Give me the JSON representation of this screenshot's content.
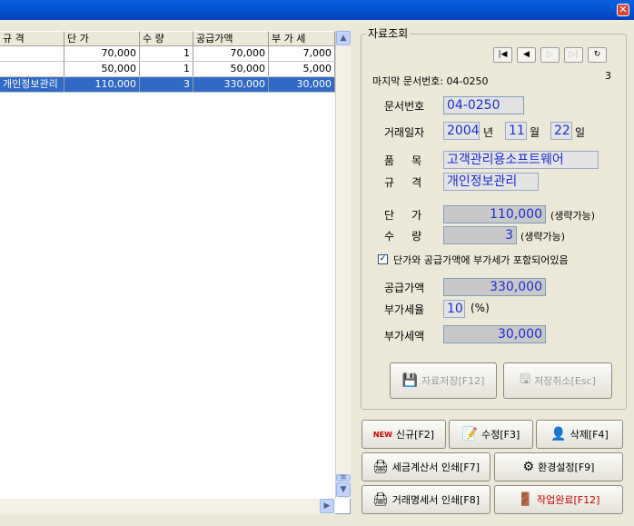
{
  "grid": {
    "columns": [
      "규 격",
      "단 가",
      "수 량",
      "공급가액",
      "부 가 세"
    ],
    "rows": [
      {
        "spec": "",
        "price": "70,000",
        "qty": "1",
        "supply": "70,000",
        "vat": "7,000",
        "selected": false
      },
      {
        "spec": "",
        "price": "50,000",
        "qty": "1",
        "supply": "50,000",
        "vat": "5,000",
        "selected": false
      },
      {
        "spec": "개인정보관리",
        "price": "110,000",
        "qty": "3",
        "supply": "330,000",
        "vat": "30,000",
        "selected": true
      }
    ]
  },
  "panel": {
    "group_title": "자료조회",
    "last_doc_label": "마지막 문서번호: 04-0250",
    "count": "3",
    "doc_no_label": "문서번호",
    "doc_no": "04-0250",
    "date_label": "거래일자",
    "year": "2004",
    "year_unit": "년",
    "month": "11",
    "month_unit": "월",
    "day": "22",
    "day_unit": "일",
    "item_label": "품     목",
    "item": "고객관리용소프트웨어",
    "spec_label": "규     격",
    "spec": "개인정보관리",
    "price_label": "단     가",
    "price": "110,000",
    "price_hint": "(생략가능)",
    "qty_label": "수     량",
    "qty": "3",
    "qty_hint": "(생략가능)",
    "vat_included_label": "단가와 공급가액에 부가세가 포함되어있음",
    "supply_label": "공급가액",
    "supply": "330,000",
    "vat_rate_label": "부가세율",
    "vat_rate": "10",
    "vat_rate_unit": "(%)",
    "vat_label": "부가세액",
    "vat": "30,000",
    "save_label": "자료저장[F12]",
    "cancel_label": "저장취소[Esc]"
  },
  "buttons": {
    "new": "신규[F2]",
    "new_badge": "NEW",
    "edit": "수정[F3]",
    "delete": "삭제[F4]",
    "tax_print": "세금계산서 인쇄[F7]",
    "settings": "환경설정[F9]",
    "statement_print": "거래명세서 인쇄[F8]",
    "done": "작업완료[F12]"
  }
}
